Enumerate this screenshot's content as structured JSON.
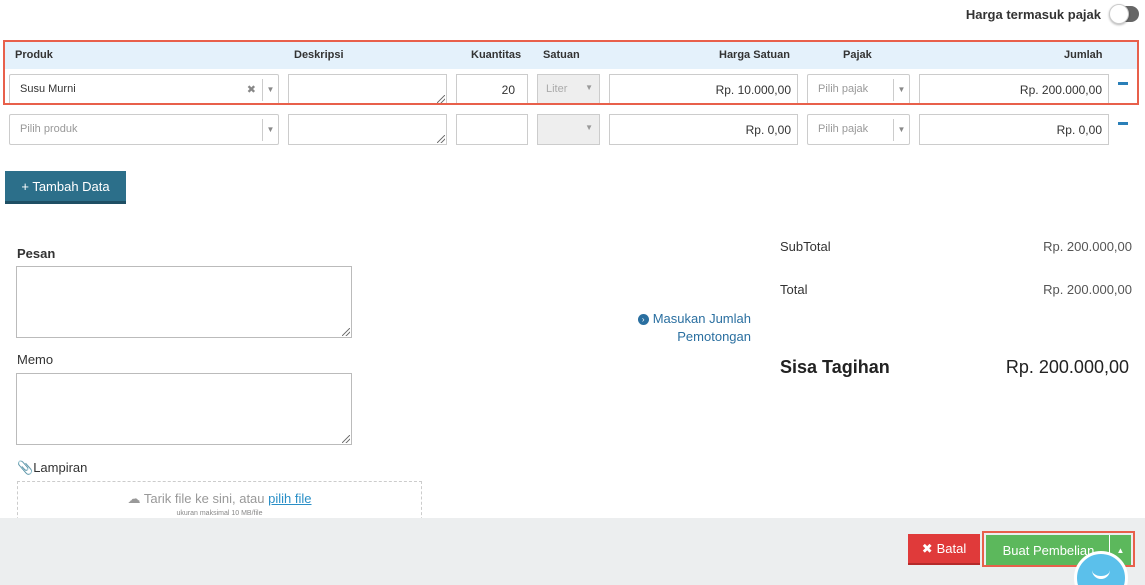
{
  "tax_toggle": {
    "label": "Harga termasuk pajak",
    "enabled": false
  },
  "table": {
    "headers": {
      "product": "Produk",
      "description": "Deskripsi",
      "quantity": "Kuantitas",
      "unit": "Satuan",
      "unit_price": "Harga Satuan",
      "tax": "Pajak",
      "amount": "Jumlah"
    },
    "rows": [
      {
        "product": "Susu Murni",
        "description": "",
        "quantity": "20",
        "unit": "Liter",
        "unit_price": "Rp. 10.000,00",
        "tax_placeholder": "Pilih pajak",
        "amount": "Rp. 200.000,00"
      },
      {
        "product_placeholder": "Pilih produk",
        "description": "",
        "quantity": "",
        "unit": "",
        "unit_price": "Rp. 0,00",
        "tax_placeholder": "Pilih pajak",
        "amount": "Rp. 0,00"
      }
    ]
  },
  "add_button": {
    "label": "+ Tambah Data"
  },
  "message": {
    "label": "Pesan",
    "value": ""
  },
  "memo": {
    "label": "Memo",
    "value": ""
  },
  "attachment": {
    "label": "Lampiran",
    "dropzone_text": "Tarik file ke sini, atau",
    "dropzone_link": "pilih file",
    "dropzone_note": "ukuran maksimal 10 MB/file"
  },
  "discount_link": {
    "line1": "Masukan Jumlah",
    "line2": "Pemotongan"
  },
  "summary": {
    "subtotal_label": "SubTotal",
    "subtotal": "Rp. 200.000,00",
    "total_label": "Total",
    "total": "Rp. 200.000,00",
    "remaining_label": "Sisa Tagihan",
    "remaining": "Rp. 200.000,00"
  },
  "footer": {
    "cancel_label": "Batal",
    "submit_label": "Buat Pembelian"
  },
  "colors": {
    "primary": "#2c6f8a",
    "success": "#5cb85c",
    "danger": "#e03a3a",
    "highlight": "#e8604b",
    "header_bg": "#e4f1fb"
  },
  "icons": {
    "clear": "times-icon",
    "caret": "caret-down-icon",
    "minus": "minus-icon",
    "upload": "cloud-upload-icon",
    "paperclip": "paperclip-icon",
    "discount": "chevron-circle-right-icon",
    "chat": "chat-icon"
  }
}
